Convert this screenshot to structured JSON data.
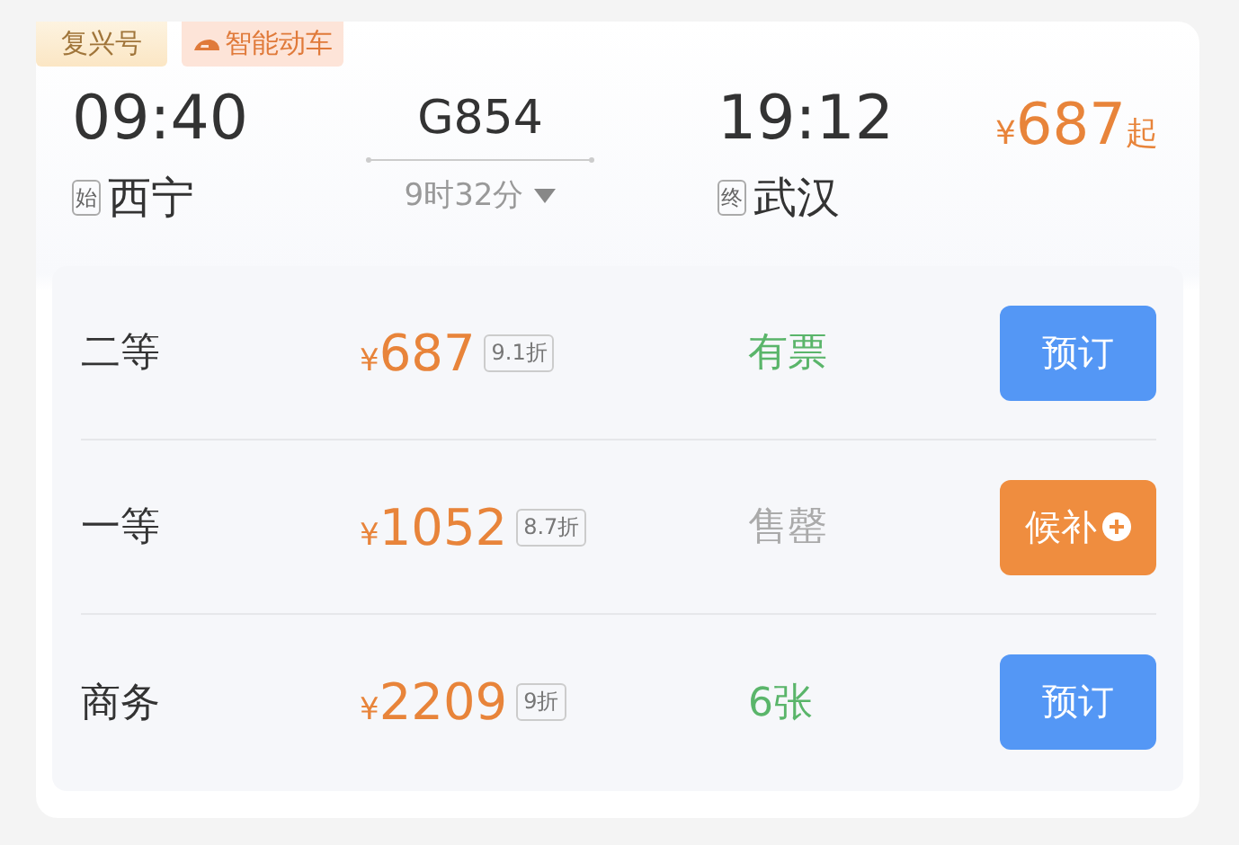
{
  "tags": [
    {
      "kind": "brand",
      "label": "复兴号"
    },
    {
      "kind": "smart",
      "label": "智能动车"
    }
  ],
  "depart": {
    "time": "09:40",
    "marker": "始",
    "station": "西宁"
  },
  "train": {
    "number": "G854",
    "duration": "9时32分"
  },
  "arrive": {
    "time": "19:12",
    "marker": "终",
    "station": "武汉"
  },
  "lowest": {
    "currency": "¥",
    "amount": "687",
    "suffix": "起"
  },
  "seats": [
    {
      "name": "二等",
      "currency": "¥",
      "price": "687",
      "discount": "9.1折",
      "availability": "有票",
      "disabled": false,
      "action": {
        "kind": "book",
        "label": "预订"
      }
    },
    {
      "name": "一等",
      "currency": "¥",
      "price": "1052",
      "discount": "8.7折",
      "availability": "售罄",
      "disabled": true,
      "action": {
        "kind": "waitlist",
        "label": "候补"
      }
    },
    {
      "name": "商务",
      "currency": "¥",
      "price": "2209",
      "discount": "9折",
      "availability": "6张",
      "disabled": false,
      "action": {
        "kind": "book",
        "label": "预订"
      }
    }
  ]
}
